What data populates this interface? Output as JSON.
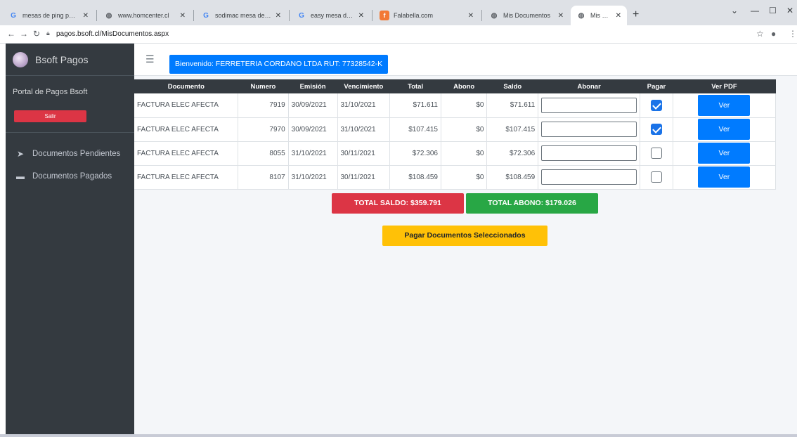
{
  "browser": {
    "tabs": [
      {
        "title": "mesas de ping pong",
        "icon": "google-icon"
      },
      {
        "title": "www.homcenter.cl",
        "icon": "globe-icon"
      },
      {
        "title": "sodimac mesa de ping",
        "icon": "google-icon"
      },
      {
        "title": "easy mesa de ping -",
        "icon": "google-icon"
      },
      {
        "title": "Falabella.com",
        "icon": "falabella-icon"
      },
      {
        "title": "Mis Documentos",
        "icon": "globe-icon"
      },
      {
        "title": "Mis Documentos",
        "icon": "globe-icon"
      }
    ],
    "active_tab": 6,
    "url": "pagos.bsoft.cl/MisDocumentos.aspx"
  },
  "sidebar": {
    "brand": "Bsoft Pagos",
    "portal_label": "Portal de Pagos Bsoft",
    "salir_label": "Salir",
    "items": [
      {
        "label": "Documentos Pendientes",
        "icon": "paper-plane-icon"
      },
      {
        "label": "Documentos Pagados",
        "icon": "money-bill-icon"
      }
    ]
  },
  "header": {
    "welcome": "Bienvenido: FERRETERIA CORDANO LTDA RUT: 77328542-K"
  },
  "table": {
    "columns": [
      "Documento",
      "Numero",
      "Emisión",
      "Vencimiento",
      "Total",
      "Abono",
      "Saldo",
      "Abonar",
      "Pagar",
      "Ver PDF"
    ],
    "rows": [
      {
        "documento": "FACTURA ELEC AFECTA",
        "numero": "7919",
        "emision": "30/09/2021",
        "vencimiento": "31/10/2021",
        "total": "$71.611",
        "abono": "$0",
        "saldo": "$71.611",
        "abonar": "",
        "pagar": true,
        "ver": "Ver"
      },
      {
        "documento": "FACTURA ELEC AFECTA",
        "numero": "7970",
        "emision": "30/09/2021",
        "vencimiento": "31/10/2021",
        "total": "$107.415",
        "abono": "$0",
        "saldo": "$107.415",
        "abonar": "",
        "pagar": true,
        "ver": "Ver"
      },
      {
        "documento": "FACTURA ELEC AFECTA",
        "numero": "8055",
        "emision": "31/10/2021",
        "vencimiento": "30/11/2021",
        "total": "$72.306",
        "abono": "$0",
        "saldo": "$72.306",
        "abonar": "",
        "pagar": false,
        "ver": "Ver"
      },
      {
        "documento": "FACTURA ELEC AFECTA",
        "numero": "8107",
        "emision": "31/10/2021",
        "vencimiento": "30/11/2021",
        "total": "$108.459",
        "abono": "$0",
        "saldo": "$108.459",
        "abonar": "",
        "pagar": false,
        "ver": "Ver"
      }
    ]
  },
  "totals": {
    "saldo": "TOTAL SALDO: $359.791",
    "abono": "TOTAL ABONO: $179.026"
  },
  "actions": {
    "pagar": "Pagar Documentos Seleccionados"
  },
  "colors": {
    "sidebar_bg": "#343a40",
    "primary": "#007bff",
    "danger": "#dc3545",
    "success": "#28a745",
    "warning": "#ffc107"
  }
}
